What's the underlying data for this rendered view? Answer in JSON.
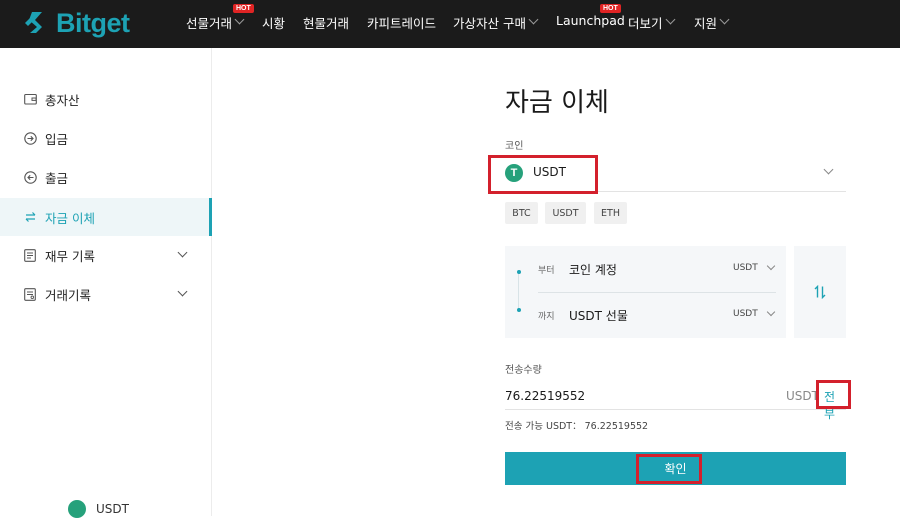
{
  "brand": {
    "name": "Bitget",
    "color": "#1da2b4"
  },
  "nav": {
    "items": [
      {
        "label": "선물거래",
        "hot": "HOT",
        "has_chevron": true
      },
      {
        "label": "시황",
        "hot": "",
        "has_chevron": false
      },
      {
        "label": "현물거래",
        "hot": "",
        "has_chevron": false
      },
      {
        "label": "카피트레이드",
        "hot": "",
        "has_chevron": false
      },
      {
        "label": "가상자산 구매",
        "hot": "",
        "has_chevron": true
      },
      {
        "label": "Launchpad",
        "hot": "HOT",
        "has_chevron": false
      },
      {
        "label": "더보기",
        "hot": "",
        "has_chevron": true
      },
      {
        "label": "지원",
        "hot": "",
        "has_chevron": true
      }
    ]
  },
  "sidebar": {
    "items": [
      {
        "label": "총자산",
        "icon": "wallet-icon",
        "active": false,
        "expandable": false
      },
      {
        "label": "입금",
        "icon": "deposit-icon",
        "active": false,
        "expandable": false
      },
      {
        "label": "출금",
        "icon": "withdraw-icon",
        "active": false,
        "expandable": false
      },
      {
        "label": "자금 이체",
        "icon": "transfer-icon",
        "active": true,
        "expandable": false
      },
      {
        "label": "재무 기록",
        "icon": "document-icon",
        "active": false,
        "expandable": true
      },
      {
        "label": "거래기록",
        "icon": "receipt-icon",
        "active": false,
        "expandable": true
      }
    ],
    "ghost_coin": "USDT"
  },
  "main": {
    "title": "자금 이체",
    "coin_label": "코인",
    "coin_selected": "USDT",
    "coin_icon_glyph": "T",
    "quick_coins": [
      "BTC",
      "USDT",
      "ETH"
    ],
    "from": {
      "tag": "부터",
      "account": "코인 계정",
      "currency": "USDT"
    },
    "to": {
      "tag": "까지",
      "account": "USDT 선물",
      "currency": "USDT"
    },
    "amount_label": "전송수량",
    "amount_value": "76.22519552",
    "amount_currency": "USDT",
    "all_label": "전부",
    "available_text": "전송 가능 USDT： 76.22519552",
    "confirm_label": "확인"
  },
  "colors": {
    "accent": "#1da2b4",
    "highlight_box": "#d3202c",
    "tether_green": "#26a17b",
    "hot_badge": "#e02424"
  }
}
